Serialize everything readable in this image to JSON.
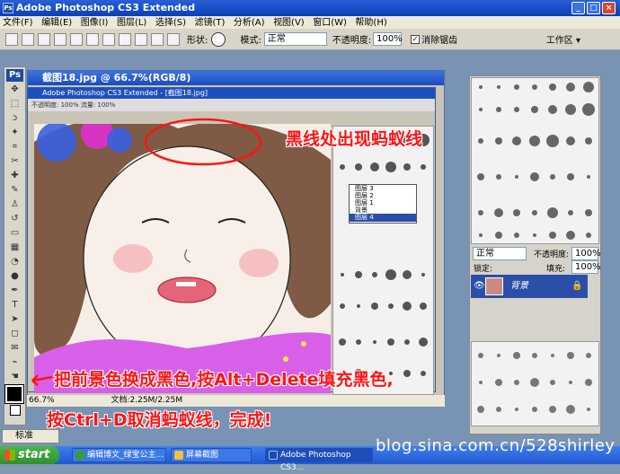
{
  "window": {
    "title": "Adobe Photoshop CS3 Extended",
    "ps_badge": "Ps",
    "minimize": "_",
    "maximize": "□",
    "close": "×"
  },
  "menu": [
    "文件(F)",
    "编辑(E)",
    "图像(I)",
    "图层(L)",
    "选择(S)",
    "滤镜(T)",
    "分析(A)",
    "视图(V)",
    "窗口(W)",
    "帮助(H)"
  ],
  "options": {
    "shape_label": "形状:",
    "mode_label": "模式:",
    "mode_value": "正常",
    "opacity_label": "不透明度:",
    "opacity_value": "100%",
    "antialias_label": "消除锯齿",
    "workspace_label": "工作区 ▾"
  },
  "document": {
    "title": "截图18.jpg @ 66.7%(RGB/8)",
    "zoom": "66.7%",
    "doc_size": "文档:2.25M/2.25M"
  },
  "inner": {
    "title": "Adobe Photoshop CS3 Extended - [截图18.jpg]",
    "opt_text": "不透明度: 100%  流量: 100%"
  },
  "inner_layers": [
    "图层 3",
    "图层 2",
    "图层 1",
    "背景",
    "图层 4"
  ],
  "layers": {
    "mode": "正常",
    "opacity_label": "不透明度:",
    "opacity_value": "100%",
    "lock_label": "锁定:",
    "fill_label": "填充:",
    "fill_value": "100%",
    "layer_name": "背景"
  },
  "annotations": {
    "top": "黑线处出现蚂蚁线",
    "bottom_line1": "把前景色换成黑色,按Alt+Delete填充黑色,",
    "bottom_line2": "按Ctrl+D取消蚂蚁线，完成!"
  },
  "toolbox": {
    "badge": "Ps",
    "std_label": "标准"
  },
  "taskbar": {
    "start": "start",
    "tasks": [
      "编辑博文_绿宝公主...",
      "屏幕截图",
      "Adobe Photoshop CS3..."
    ]
  },
  "watermark": "blog.sina.com.cn/528shirley",
  "colors": {
    "annotation": "#ff1414",
    "titlebar": "#0a3fb8",
    "selection": "#2b4fa8"
  }
}
